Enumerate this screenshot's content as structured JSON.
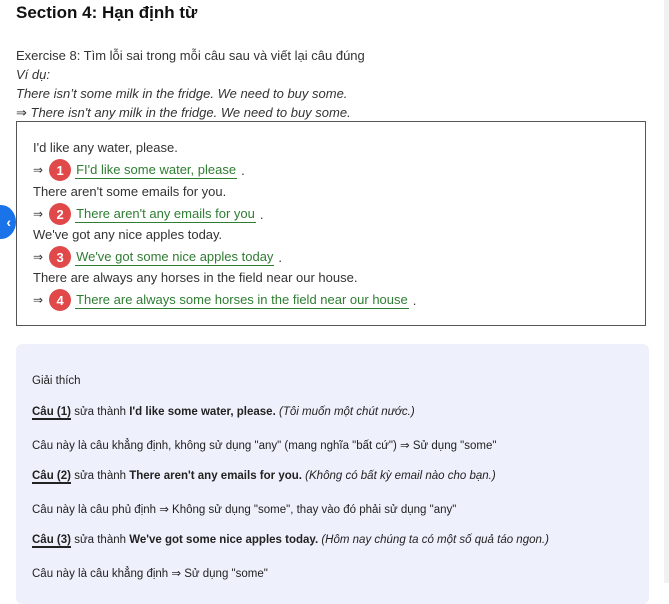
{
  "section_title": "Section 4: Hạn định từ",
  "intro": {
    "exercise": "Exercise 8: Tìm lỗi sai trong mỗi câu sau và viết lại câu đúng",
    "example_label": "Ví dụ:",
    "example_wrong": "There isn’t some milk in the fridge. We need to buy some.",
    "example_right": "⇒ There isn't any milk in the fridge. We need to buy some."
  },
  "items": [
    {
      "number": "1",
      "question": "I'd like any water, please.",
      "answer": "FI'd like some water, please"
    },
    {
      "number": "2",
      "question": "There aren't some emails for you.",
      "answer": "There aren't any emails for you"
    },
    {
      "number": "3",
      "question": "We've got any nice apples today.",
      "answer": "We've got some nice apples today"
    },
    {
      "number": "4",
      "question": "There are always any horses in the field near our house.",
      "answer": "There are always some horses in the field near our house"
    }
  ],
  "arrow": "⇒",
  "period": ".",
  "explanation": {
    "heading": "Giải thích",
    "c1_label": "Câu (1)",
    "c1_mid": "sửa thành",
    "c1_fix": "I'd like some water, please.",
    "c1_trans": "(Tôi muốn một chút nước.)",
    "c1_note": "Câu này là câu khẳng định, không sử dụng \"any\" (mang nghĩa \"bất cứ\") ⇒ Sử dụng \"some\"",
    "c2_label": "Câu (2)",
    "c2_mid": "sửa thành",
    "c2_fix": "There aren't any emails for you.",
    "c2_trans": "(Không có bất kỳ email nào cho bạn.)",
    "c2_note": "Câu này là câu phủ định ⇒ Không sử dụng \"some\", thay vào đó phải sử dụng \"any\"",
    "c3_label": "Câu (3)",
    "c3_mid": "sửa thành",
    "c3_fix": "We've got some nice apples today.",
    "c3_trans": "(Hôm nay chúng ta có một số quả táo ngon.)",
    "c3_note": "Câu này là câu khẳng định ⇒ Sử dụng \"some\""
  },
  "icons": {
    "left_tab": "chevron-left-icon"
  },
  "colors": {
    "accent_red": "#e0484a",
    "answer_green": "#2e7d32",
    "panel_bg": "#eef1fb",
    "tab_blue": "#1a73e8"
  }
}
